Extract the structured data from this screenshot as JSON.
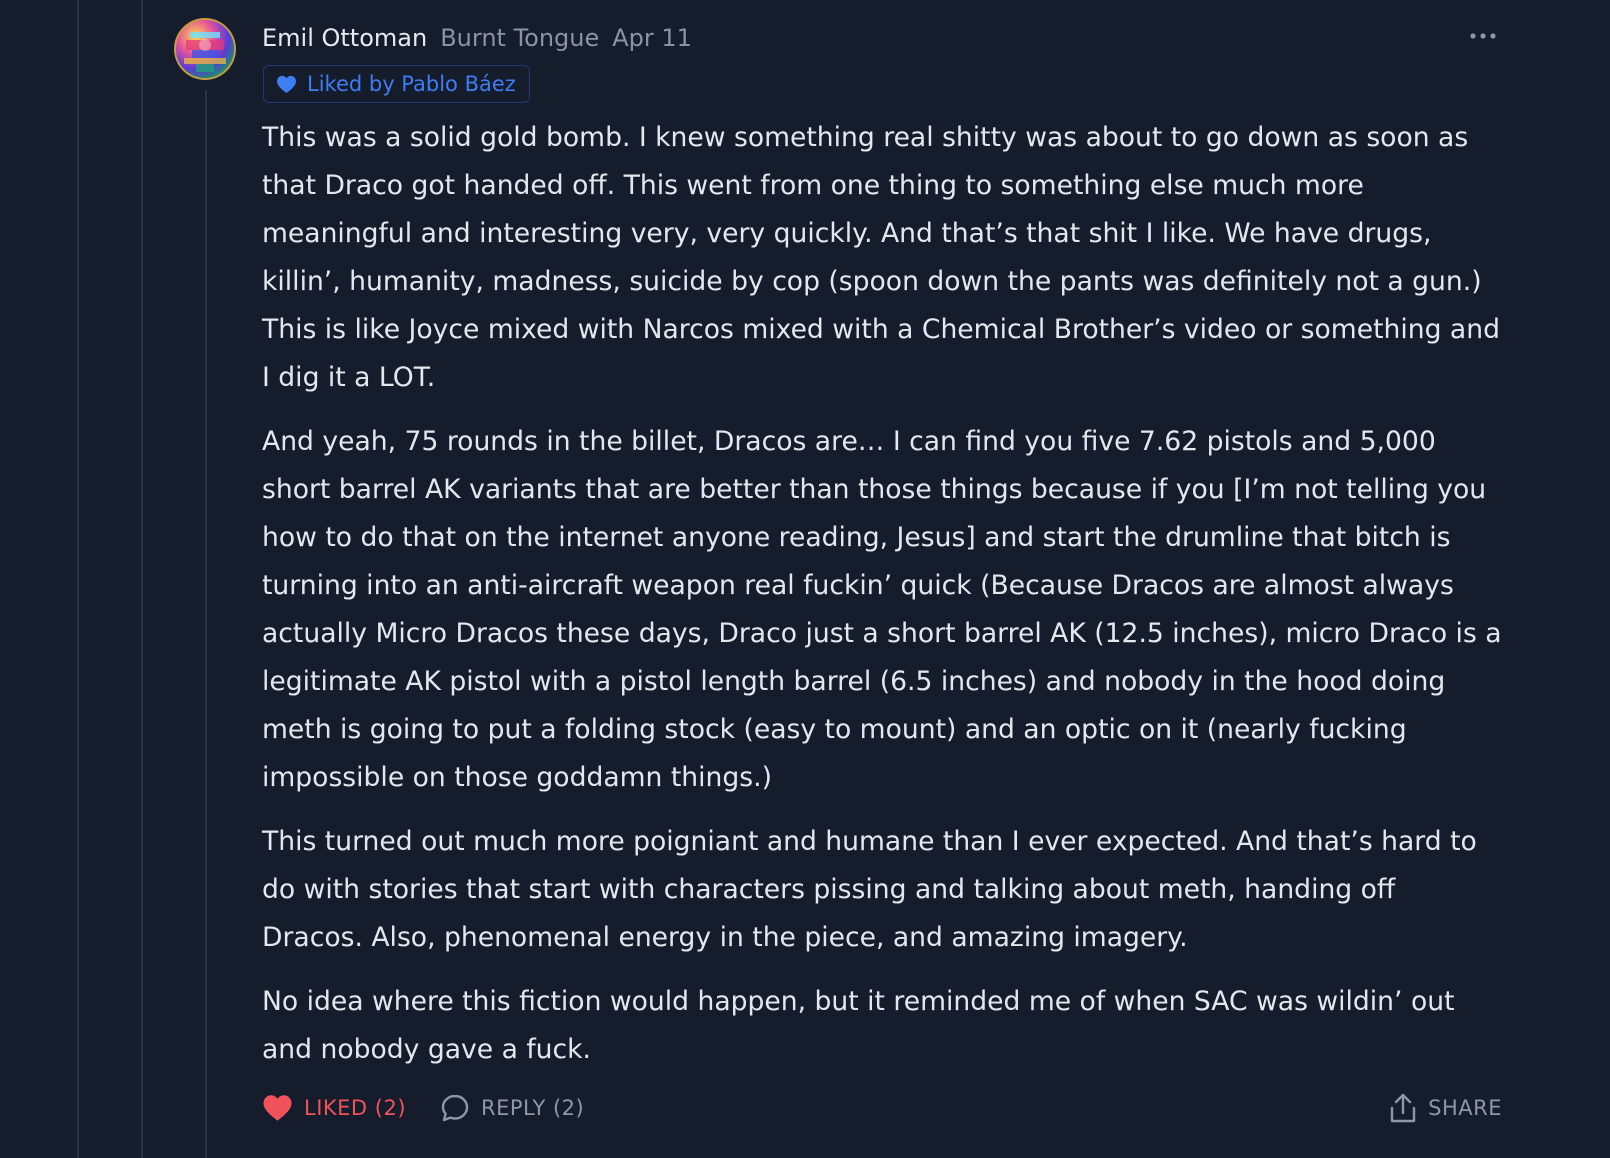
{
  "comment": {
    "author": "Emil Ottoman",
    "publication": "Burnt Tongue",
    "date": "Apr 11",
    "liked_by": "Liked by Pablo Báez",
    "more_icon": "more-horizontal-icon",
    "paragraphs": [
      "This was a solid gold bomb. I knew something real shitty was about to go down as soon as that Draco got handed off. This went from one thing to something else much more meaningful and interesting very, very quickly. And that’s that shit I like. We have drugs, killin’, humanity, madness, suicide by cop (spoon down the pants was definitely not a gun.) This is like Joyce mixed with Narcos mixed with a Chemical Brother’s video or something and I dig it a LOT.",
      "And yeah, 75 rounds in the billet, Dracos are… I can find you five 7.62 pistols and 5,000 short barrel AK variants that are better than those things because if you [I’m not telling you how to do that on the internet anyone reading, Jesus] and start the drumline that bitch is turning into an anti-aircraft weapon real fuckin’ quick (Because Dracos are almost always actually Micro Dracos these days, Draco just a short barrel AK (12.5 inches), micro Draco is a legitimate AK pistol with a pistol length barrel (6.5 inches) and nobody in the hood doing meth is going to put a folding stock (easy to mount) and an optic on it (nearly fucking impossible on those goddamn things.)",
      "This turned out much more poigniant and humane than I ever expected. And that’s hard to do with stories that start with characters pissing and talking about meth, handing off Dracos. Also, phenomenal energy in the piece, and amazing imagery.",
      "No idea where this fiction would happen, but it reminded me of when SAC was wildin’ out and nobody gave a fuck."
    ]
  },
  "actions": {
    "like_label": "LIKED (2)",
    "reply_label": "REPLY (2)",
    "share_label": "SHARE"
  },
  "colors": {
    "background": "#151c2b",
    "text": "#e4e7ee",
    "muted": "#8b92a3",
    "like": "#f0525a",
    "badge_blue": "#3f7df3"
  }
}
